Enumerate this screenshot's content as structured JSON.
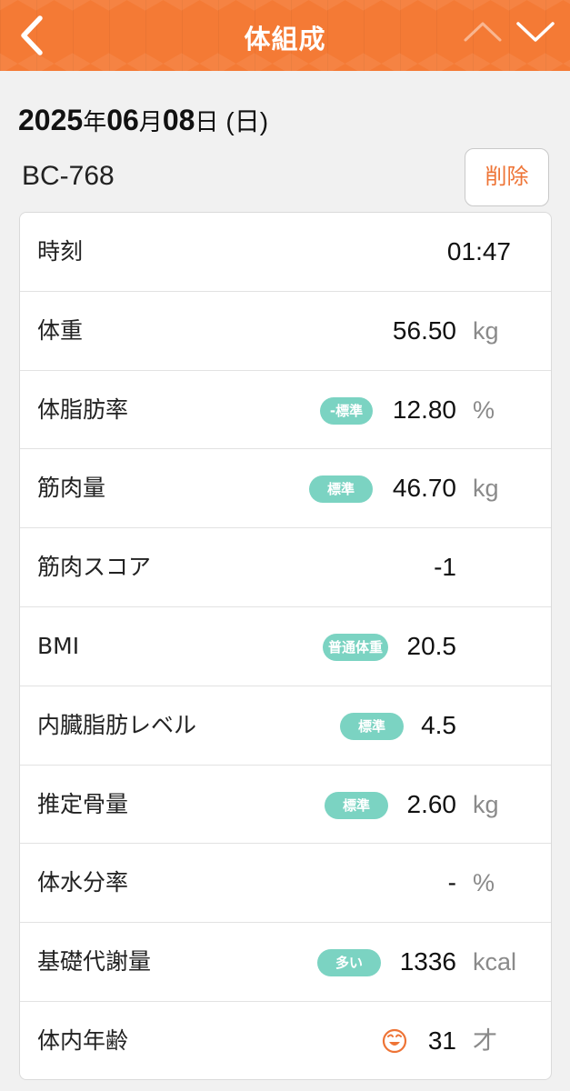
{
  "header": {
    "title": "体組成",
    "back_icon": "chevron-left-icon",
    "prev_icon": "chevron-up-icon",
    "next_icon": "chevron-down-icon",
    "color": "#f47a35"
  },
  "date": {
    "year": "2025",
    "year_unit": "年",
    "month": "06",
    "month_unit": "月",
    "day": "08",
    "day_unit": "日",
    "weekday": "(日)"
  },
  "device": {
    "model": "BC-768",
    "delete_label": "削除"
  },
  "badge_color": "#7bd3c2",
  "rows": [
    {
      "label": "時刻",
      "value": "01:47"
    },
    {
      "label": "体重",
      "value": "56.50",
      "unit": "kg"
    },
    {
      "label": "体脂肪率",
      "badge": "-標準",
      "value": "12.80",
      "unit": "%"
    },
    {
      "label": "筋肉量",
      "badge": "標準",
      "value": "46.70",
      "unit": "kg"
    },
    {
      "label": "筋肉スコア",
      "value": "-1"
    },
    {
      "label": "BMI",
      "badge": "普通体重",
      "value": "20.5"
    },
    {
      "label": "内臓脂肪レベル",
      "badge": "標準",
      "value": "4.5"
    },
    {
      "label": "推定骨量",
      "badge": "標準",
      "value": "2.60",
      "unit": "kg"
    },
    {
      "label": "体水分率",
      "value": "-",
      "unit": "%"
    },
    {
      "label": "基礎代謝量",
      "badge": "多い",
      "value": "1336",
      "unit": "kcal"
    },
    {
      "label": "体内年齢",
      "icon": "smiley-face-icon",
      "value": "31",
      "unit": "才"
    }
  ]
}
